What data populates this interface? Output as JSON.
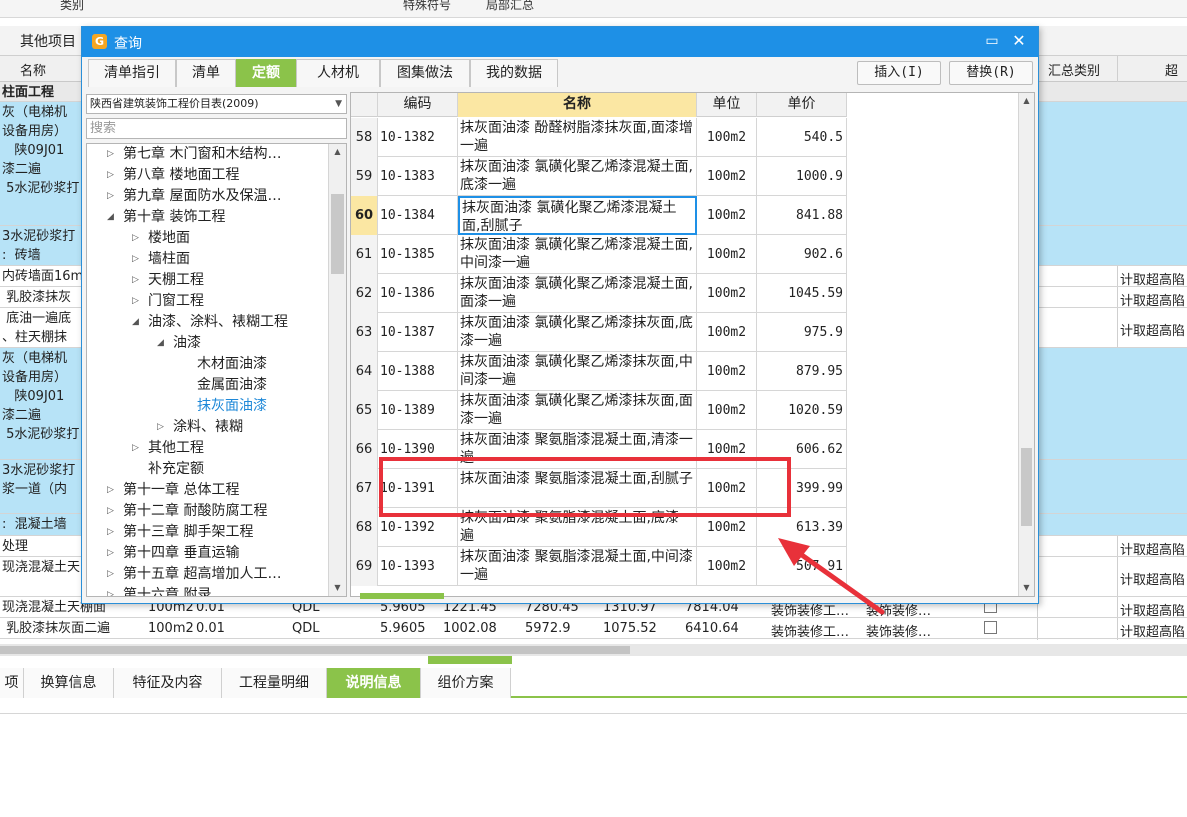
{
  "background": {
    "top_strip": [
      "类别",
      "特殊符号",
      "局部汇总"
    ],
    "tab_label": "其他项目",
    "headers": {
      "name": "名称",
      "summary_type": "汇总类别",
      "over": "超高"
    },
    "section_title": "柱面工程",
    "rows": [
      {
        "text": "灰（电梯机\n设备用房）\n   陕09J01\n漆二遍\n 5水泥砂浆打",
        "blue": true,
        "h": 124
      },
      {
        "text": "3水泥砂浆打\n:  砖墙",
        "blue": true,
        "h": 40
      },
      {
        "text": "内砖墙面16m",
        "right": "计取超高陷",
        "h": 21
      },
      {
        "text": " 乳胶漆抹灰",
        "right": "计取超高陷",
        "h": 21
      },
      {
        "text": " 底油一遍底\n、柱天棚抹",
        "right": "计取超高陷",
        "h": 40
      },
      {
        "text": "灰（电梯机\n设备用房）\n   陕09J01\n漆二遍\n 5水泥砂浆打",
        "blue": true,
        "h": 112
      },
      {
        "text": "3水泥砂浆打\n浆一道（内",
        "blue": true,
        "h": 54
      },
      {
        "text": ":  混凝土墙",
        "blue": true,
        "h": 22
      },
      {
        "text": "处理",
        "right": "计取超高陷",
        "h": 21
      },
      {
        "text": "现浇混凝土天",
        "right": "计取超高陷",
        "h": 40
      },
      {
        "text": "现浇混凝土天棚面",
        "right": "计取超高陷",
        "h": 21,
        "cells": [
          "100m2",
          "0.01",
          "QDL",
          "5.9605",
          "1221.45",
          "7280.45",
          "1310.97",
          "7814.04",
          "装饰装修工…",
          "装饰装修…"
        ]
      },
      {
        "text": " 乳胶漆抹灰面二遍",
        "right": "计取超高陷",
        "h": 21,
        "cells": [
          "100m2",
          "0.01",
          "QDL",
          "5.9605",
          "1002.08",
          "5972.9",
          "1075.52",
          "6410.64",
          "装饰装修工…",
          "装饰装修…"
        ]
      }
    ],
    "bottom_tabs": [
      {
        "label": "项",
        "active": false
      },
      {
        "label": "换算信息",
        "active": false
      },
      {
        "label": "特征及内容",
        "active": false
      },
      {
        "label": "工程量明细",
        "active": false
      },
      {
        "label": "说明信息",
        "active": true
      },
      {
        "label": "组价方案",
        "active": false
      }
    ]
  },
  "dialog": {
    "title": "查询",
    "logo_char": "G",
    "max_glyph": "▭",
    "close_glyph": "✕",
    "tabs": [
      {
        "label": "清单指引",
        "active": false
      },
      {
        "label": "清单",
        "active": false
      },
      {
        "label": "定额",
        "active": true
      },
      {
        "label": "人材机",
        "active": false
      },
      {
        "label": "图集做法",
        "active": false
      },
      {
        "label": "我的数据",
        "active": false
      }
    ],
    "insert_label": "插入(I)",
    "replace_label": "替换(R)",
    "library": "陕西省建筑装饰工程价目表(2009)",
    "search_placeholder": "搜索",
    "tree": [
      {
        "label": "第七章  木门窗和木结构…",
        "level": 0,
        "toggle": "▷"
      },
      {
        "label": "第八章  楼地面工程",
        "level": 0,
        "toggle": "▷"
      },
      {
        "label": "第九章  屋面防水及保温…",
        "level": 0,
        "toggle": "▷"
      },
      {
        "label": "第十章  装饰工程",
        "level": 0,
        "toggle": "◢"
      },
      {
        "label": "楼地面",
        "level": 1,
        "toggle": "▷"
      },
      {
        "label": "墙柱面",
        "level": 1,
        "toggle": "▷"
      },
      {
        "label": "天棚工程",
        "level": 1,
        "toggle": "▷"
      },
      {
        "label": "门窗工程",
        "level": 1,
        "toggle": "▷"
      },
      {
        "label": "油漆、涂料、裱糊工程",
        "level": 1,
        "toggle": "◢"
      },
      {
        "label": "油漆",
        "level": 2,
        "toggle": "◢"
      },
      {
        "label": "木材面油漆",
        "level": 3,
        "toggle": ""
      },
      {
        "label": "金属面油漆",
        "level": 3,
        "toggle": ""
      },
      {
        "label": "抹灰面油漆",
        "level": 3,
        "toggle": "",
        "selected": true
      },
      {
        "label": "涂料、裱糊",
        "level": 2,
        "toggle": "▷"
      },
      {
        "label": "其他工程",
        "level": 1,
        "toggle": "▷"
      },
      {
        "label": "补充定额",
        "level": 1,
        "toggle": ""
      },
      {
        "label": "第十一章  总体工程",
        "level": 0,
        "toggle": "▷"
      },
      {
        "label": "第十二章  耐酸防腐工程",
        "level": 0,
        "toggle": "▷"
      },
      {
        "label": "第十三章  脚手架工程",
        "level": 0,
        "toggle": "▷"
      },
      {
        "label": "第十四章  垂直运输",
        "level": 0,
        "toggle": "▷"
      },
      {
        "label": "第十五章  超高增加人工…",
        "level": 0,
        "toggle": "▷"
      },
      {
        "label": "第十六章  附录",
        "level": 0,
        "toggle": "▷"
      }
    ],
    "grid_headers": {
      "index": "",
      "code": "编码",
      "name": "名称",
      "unit": "单位",
      "price": "单价"
    },
    "rows": [
      {
        "idx": "58",
        "code": "10-1382",
        "name": "抹灰面油漆 酚醛树脂漆抹灰面,面漆增一遍",
        "unit": "100m2",
        "price": "540.5"
      },
      {
        "idx": "59",
        "code": "10-1383",
        "name": "抹灰面油漆 氯磺化聚乙烯漆混凝土面,底漆一遍",
        "unit": "100m2",
        "price": "1000.9"
      },
      {
        "idx": "60",
        "code": "10-1384",
        "name": "抹灰面油漆 氯磺化聚乙烯漆混凝土面,刮腻子",
        "unit": "100m2",
        "price": "841.88",
        "current": true
      },
      {
        "idx": "61",
        "code": "10-1385",
        "name": "抹灰面油漆 氯磺化聚乙烯漆混凝土面,中间漆一遍",
        "unit": "100m2",
        "price": "902.6"
      },
      {
        "idx": "62",
        "code": "10-1386",
        "name": "抹灰面油漆 氯磺化聚乙烯漆混凝土面,面漆一遍",
        "unit": "100m2",
        "price": "1045.59"
      },
      {
        "idx": "63",
        "code": "10-1387",
        "name": "抹灰面油漆 氯磺化聚乙烯漆抹灰面,底漆一遍",
        "unit": "100m2",
        "price": "975.9"
      },
      {
        "idx": "64",
        "code": "10-1388",
        "name": "抹灰面油漆 氯磺化聚乙烯漆抹灰面,中间漆一遍",
        "unit": "100m2",
        "price": "879.95"
      },
      {
        "idx": "65",
        "code": "10-1389",
        "name": "抹灰面油漆 氯磺化聚乙烯漆抹灰面,面漆一遍",
        "unit": "100m2",
        "price": "1020.59"
      },
      {
        "idx": "66",
        "code": "10-1390",
        "name": "抹灰面油漆 聚氨脂漆混凝土面,清漆一遍",
        "unit": "100m2",
        "price": "606.62"
      },
      {
        "idx": "67",
        "code": "10-1391",
        "name": "抹灰面油漆 聚氨脂漆混凝土面,刮腻子",
        "unit": "100m2",
        "price": "399.99"
      },
      {
        "idx": "68",
        "code": "10-1392",
        "name": "抹灰面油漆 聚氨脂漆混凝土面,底漆一遍",
        "unit": "100m2",
        "price": "613.39"
      },
      {
        "idx": "69",
        "code": "10-1393",
        "name": "抹灰面油漆 聚氨脂漆混凝土面,中间漆一遍",
        "unit": "100m2",
        "price": "507.91"
      }
    ]
  },
  "colors": {
    "accent_green": "#8bc34a",
    "title_blue": "#1e90e6",
    "highlight": "#e8313a",
    "row_blue": "#b7e3f7"
  }
}
